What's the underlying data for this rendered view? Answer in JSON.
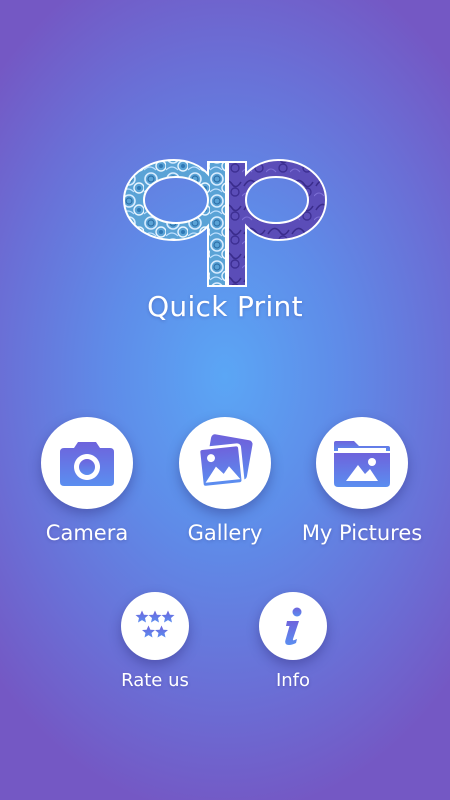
{
  "app": {
    "title": "Quick Print",
    "logo_icon": "qp-logo-icon"
  },
  "menu": {
    "camera": {
      "label": "Camera",
      "icon": "camera-icon"
    },
    "gallery": {
      "label": "Gallery",
      "icon": "gallery-icon"
    },
    "my_pictures": {
      "label": "My Pictures",
      "icon": "folder-picture-icon"
    },
    "rate_us": {
      "label": "Rate us",
      "icon": "stars-icon"
    },
    "info": {
      "label": "Info",
      "icon": "info-icon"
    }
  },
  "colors": {
    "background_center": "#5ba6f5",
    "background_edge": "#7458c4",
    "icon_gradient_top": "#6e63dc",
    "icon_gradient_bottom": "#5b8ef0",
    "button_fill": "#ffffff",
    "label_text": "#ffffff"
  }
}
